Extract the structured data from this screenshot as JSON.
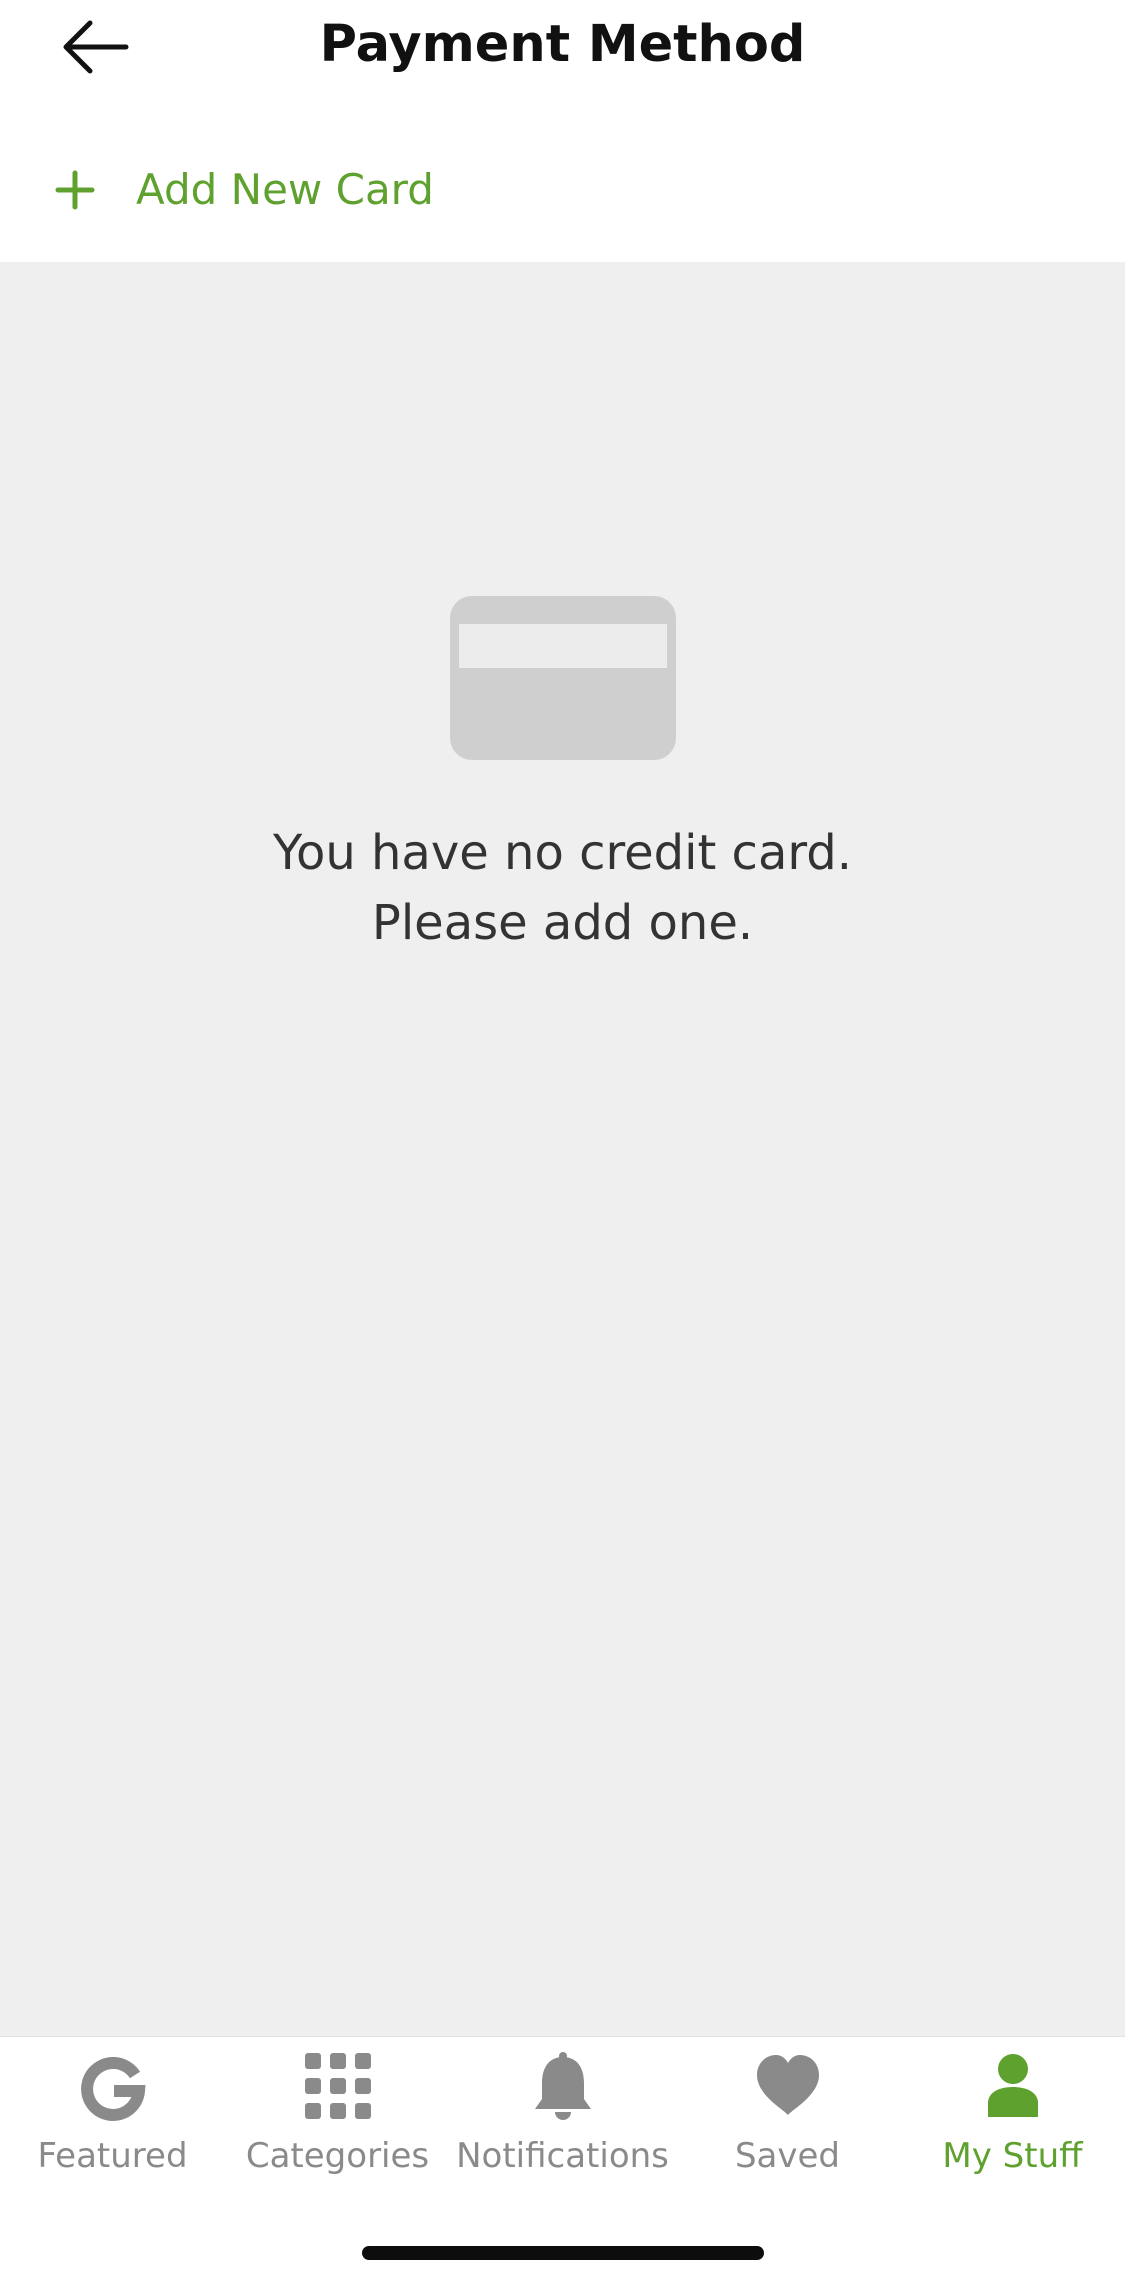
{
  "header": {
    "title": "Payment Method",
    "add_card_label": "Add New Card"
  },
  "empty_state": {
    "icon": "credit-card-icon",
    "line1": "You have no credit card.",
    "line2": "Please add one."
  },
  "tabbar": {
    "tabs": [
      {
        "label": "Featured",
        "icon": "featured-g-icon",
        "active": false
      },
      {
        "label": "Categories",
        "icon": "grid-icon",
        "active": false
      },
      {
        "label": "Notifications",
        "icon": "bell-icon",
        "active": false
      },
      {
        "label": "Saved",
        "icon": "heart-icon",
        "active": false
      },
      {
        "label": "My Stuff",
        "icon": "person-icon",
        "active": true
      }
    ]
  },
  "colors": {
    "accent": "#5fa12e",
    "inactive": "#8a8a8a",
    "background": "#efefef",
    "card_icon": "#cfcfcf"
  }
}
